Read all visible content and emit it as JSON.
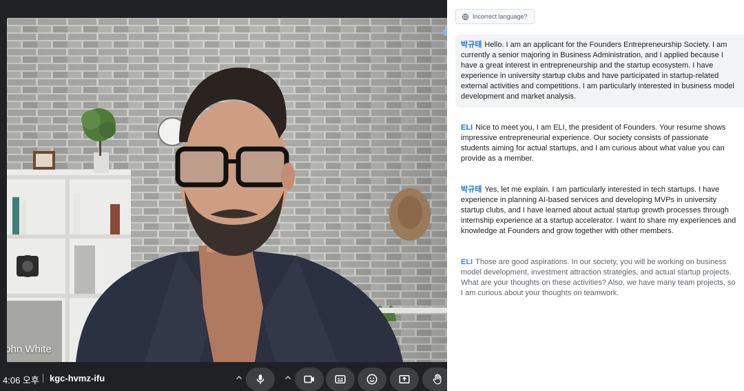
{
  "call": {
    "participant_name": "ɔhn White",
    "time": "4:06 오후",
    "meeting_code": "kgc-hvmz-ifu"
  },
  "controls": {
    "icons": [
      "chevron-up-icon",
      "microphone-icon",
      "chevron-up-icon",
      "camera-icon",
      "captions-icon",
      "emoji-icon",
      "present-screen-icon",
      "raise-hand-icon"
    ]
  },
  "captions_panel": {
    "incorrect_language_label": "Incorrect language?",
    "entries": [
      {
        "speaker": "박규태",
        "text": "Hello. I am an applicant for the Founders Entrepreneurship Society. I am currently a senior majoring in Business Administration, and I applied because I have a great interest in entrepreneurship and the startup ecosystem. I have experience in university startup clubs and have participated in startup-related external activities and competitions. I am particularly interested in business model development and market analysis."
      },
      {
        "speaker": "ELI",
        "text": "Nice to meet you, I am ELI, the president of Founders. Your resume shows impressive entrepreneurial experience. Our society consists of passionate students aiming for actual startups, and I am curious about what value you can provide as a member."
      },
      {
        "speaker": "박규태",
        "text": "Yes, let me explain. I am particularly interested in tech startups. I have experience in planning AI-based services and developing MVPs in university startup clubs, and I have learned about actual startup growth processes through internship experience at a startup accelerator. I want to share my experiences and knowledge at Founders and grow together with other members."
      },
      {
        "speaker": "ELI",
        "text": "Those are good aspirations. In our society, you will be working on business model development, investment attraction strategies, and actual startup projects. What are your thoughts on these activities? Also, we have many team projects, so I am curious about your thoughts on teamwork."
      }
    ]
  },
  "colors": {
    "speaker_accent": "#1a73e8",
    "panel_bg": "#ffffff",
    "call_bg": "#202124",
    "control_bg": "#3c4043"
  }
}
